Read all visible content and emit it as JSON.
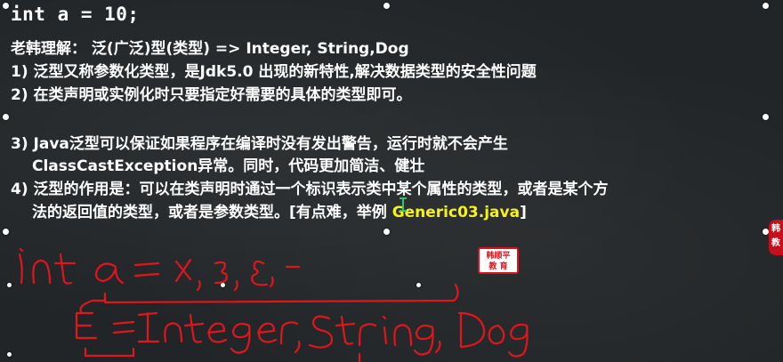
{
  "code_line": "int a = 10;",
  "notes": {
    "line1": "老韩理解： 泛(广泛)型(类型) => Integer, String,Dog",
    "line2": "1) 泛型又称参数化类型，是Jdk5.0 出现的新特性,解决数据类型的安全性问题",
    "line3": "2) 在类声明或实例化时只要指定好需要的具体的类型即可。",
    "line4": "3) Java泛型可以保证如果程序在编译时没有发出警告，运行时就不会产生",
    "line5": "ClassCastException异常。同时，代码更加简洁、健壮",
    "line6": "4) 泛型的作用是：可以在类声明时通过一个标识表示类中某个属性的类型，或者是某个方",
    "line7_prefix": "法的返回值的类型，或者是参数类型。[有点难，举例 ",
    "line7_highlight": "Generic03.java",
    "line7_suffix": "]"
  },
  "seal": {
    "line1": "韩顺平",
    "line2": "教 育"
  },
  "side_tab": {
    "line1": "韩",
    "line2": "教"
  },
  "colors": {
    "background": "#222527",
    "text": "#ffffff",
    "highlight": "#f6f21a",
    "ink": "#e0161c"
  }
}
